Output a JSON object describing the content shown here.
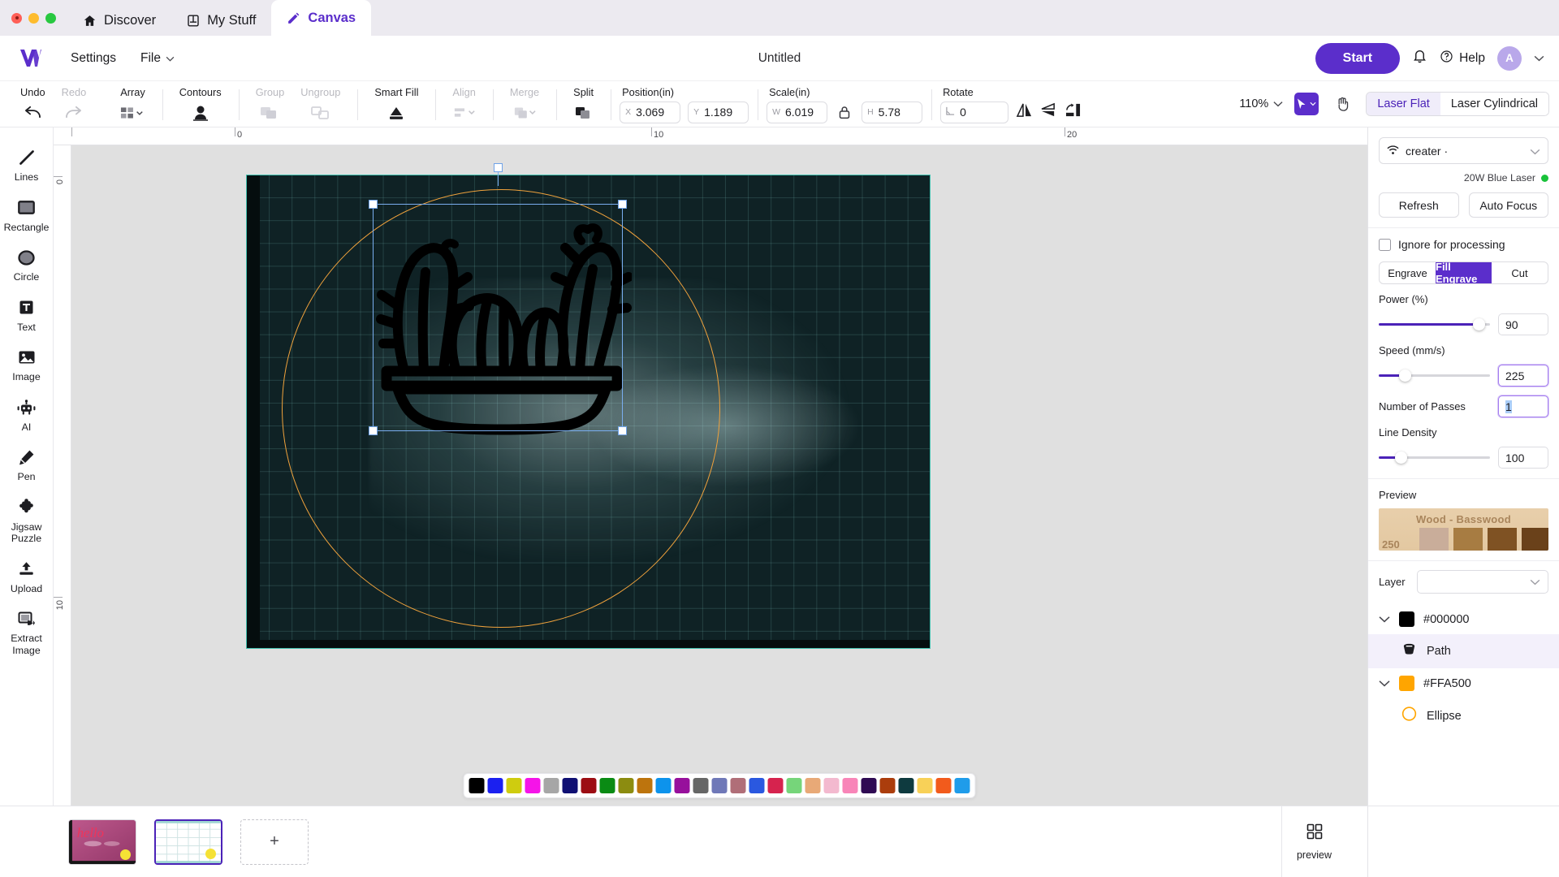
{
  "window": {
    "traffic_lights": [
      "close",
      "minimize",
      "maximize"
    ],
    "tabs": [
      {
        "label": "Discover",
        "icon": "home-icon",
        "active": false
      },
      {
        "label": "My Stuff",
        "icon": "book-icon",
        "active": false
      },
      {
        "label": "Canvas",
        "icon": "pencil-icon",
        "active": true
      }
    ]
  },
  "header": {
    "logo": "xtool-logo",
    "settings_label": "Settings",
    "file_label": "File",
    "document_title": "Untitled",
    "start_label": "Start",
    "help_label": "Help",
    "bell_icon": "notification-bell-icon",
    "avatar_initial": "A",
    "caret_icon": "chevron-down-icon",
    "accent_color": "#5b2ecb"
  },
  "toolbar": {
    "history": [
      {
        "label": "Undo",
        "icon": "undo-arrow-icon",
        "disabled": false
      },
      {
        "label": "Redo",
        "icon": "redo-arrow-icon",
        "disabled": true
      }
    ],
    "tools": [
      {
        "label": "Array",
        "icon": "array-grid-icon",
        "disabled": false
      },
      {
        "label": "Contours",
        "icon": "contours-icon",
        "disabled": false
      },
      {
        "label": "Group",
        "icon": "group-icon",
        "disabled": true
      },
      {
        "label": "Ungroup",
        "icon": "ungroup-icon",
        "disabled": true
      },
      {
        "label": "Smart Fill",
        "icon": "smart-fill-icon",
        "disabled": false
      },
      {
        "label": "Align",
        "icon": "align-icon",
        "disabled": true
      },
      {
        "label": "Merge",
        "icon": "merge-icon",
        "disabled": true
      },
      {
        "label": "Split",
        "icon": "split-icon",
        "disabled": false
      }
    ],
    "position": {
      "label": "Position(in)",
      "x": {
        "tag": "X",
        "value": "3.069"
      },
      "y": {
        "tag": "Y",
        "value": "1.189"
      }
    },
    "scale": {
      "label": "Scale(in)",
      "w": {
        "tag": "W",
        "value": "6.019"
      },
      "h": {
        "tag": "H",
        "value": "5.78"
      },
      "lock_icon": "lock-icon"
    },
    "rotate": {
      "label": "Rotate",
      "angle": {
        "tag": "angle-icon",
        "value": "0"
      },
      "flip_horizontal_icon": "flip-horizontal-icon",
      "flip_vertical_icon": "flip-vertical-icon",
      "rotate-90_icon": "rotate-90-icon"
    },
    "zoom_level": "110%",
    "select_tool_icon": "cursor-select-icon",
    "pan_tool_icon": "hand-pan-icon",
    "view_modes": [
      {
        "label": "Laser Flat",
        "active": true
      },
      {
        "label": "Laser Cylindrical",
        "active": false
      }
    ]
  },
  "left_rail": {
    "items": [
      {
        "label": "Lines",
        "icon": "line-tool-icon"
      },
      {
        "label": "Rectangle",
        "icon": "rectangle-tool-icon"
      },
      {
        "label": "Circle",
        "icon": "circle-tool-icon"
      },
      {
        "label": "Text",
        "icon": "text-tool-icon"
      },
      {
        "label": "Image",
        "icon": "image-tool-icon"
      },
      {
        "label": "AI",
        "icon": "ai-robot-icon"
      },
      {
        "label": "Pen",
        "icon": "pen-tool-icon"
      },
      {
        "label": "Jigsaw Puzzle",
        "icon": "jigsaw-puzzle-icon"
      },
      {
        "label": "Upload",
        "icon": "upload-icon"
      },
      {
        "label": "Extract Image",
        "icon": "extract-image-icon"
      }
    ]
  },
  "canvas": {
    "ruler_h_labels": [
      "0",
      "10",
      "20"
    ],
    "ruler_v_labels": [
      "0",
      "10"
    ],
    "artwork_name": "cactus-in-pot-silhouette",
    "selection": {
      "visible": true,
      "rotate_handle": true
    },
    "ellipse_color": "#FFA500",
    "bed_border_color": "#3fbfae"
  },
  "palette": {
    "colors": [
      "#000000",
      "#1b20f0",
      "#cfcc0f",
      "#f514e8",
      "#a6a6a6",
      "#101073",
      "#9c0d13",
      "#0a8b14",
      "#8c8c10",
      "#bd740d",
      "#0d93ec",
      "#97109c",
      "#666666",
      "#6f78b8",
      "#b06e78",
      "#2a58e0",
      "#d6234e",
      "#76d57a",
      "#e8a977",
      "#f3b9cf",
      "#f885b8",
      "#2f0a53",
      "#ab3d0c",
      "#0e3a3f",
      "#f8d158",
      "#f25b1c",
      "#1f9cea"
    ]
  },
  "right_panel": {
    "device": {
      "name": "creater ·",
      "wifi_icon": "wifi-icon",
      "chevron_icon": "chevron-down-icon"
    },
    "laser_module": "20W Blue Laser",
    "status_color": "#19c23a",
    "refresh_label": "Refresh",
    "auto_focus_label": "Auto Focus",
    "ignore_label": "Ignore for processing",
    "ignore_checked": false,
    "modes": [
      {
        "label": "Engrave",
        "active": false
      },
      {
        "label": "Fill Engrave",
        "active": true
      },
      {
        "label": "Cut",
        "active": false
      }
    ],
    "settings": [
      {
        "label": "Power (%)",
        "value": "90",
        "slider": true,
        "percent": 90,
        "focused": false
      },
      {
        "label": "Speed (mm/s)",
        "value": "225",
        "slider": true,
        "percent": 23,
        "focused": true
      },
      {
        "label": "Number of Passes",
        "value": "1",
        "slider": false,
        "percent": 0,
        "focused": true
      },
      {
        "label": "Line Density",
        "value": "100",
        "slider": true,
        "percent": 20,
        "focused": false
      }
    ],
    "preview_label": "Preview",
    "preview_material": "Wood - Basswood",
    "preview_number": "250",
    "layer_label": "Layer",
    "tree": [
      {
        "color": "#000000",
        "name": "#000000",
        "expanded": true,
        "children": [
          {
            "name": "Path",
            "icon": "path-shape-icon",
            "selected": true
          }
        ]
      },
      {
        "color": "#FFA500",
        "name": "#FFA500",
        "expanded": true,
        "children": [
          {
            "name": "Ellipse",
            "icon": "ellipse-shape-icon",
            "selected": false
          }
        ]
      }
    ]
  },
  "bottom_bar": {
    "thumbnails": [
      {
        "name": "hello-project",
        "active": false,
        "has_dot": true,
        "label": "hello"
      },
      {
        "name": "cactus-project",
        "active": true,
        "has_dot": true,
        "label": ""
      }
    ],
    "add_label": "+",
    "preview_label": "preview",
    "preview_icon": "grid-preview-icon"
  }
}
